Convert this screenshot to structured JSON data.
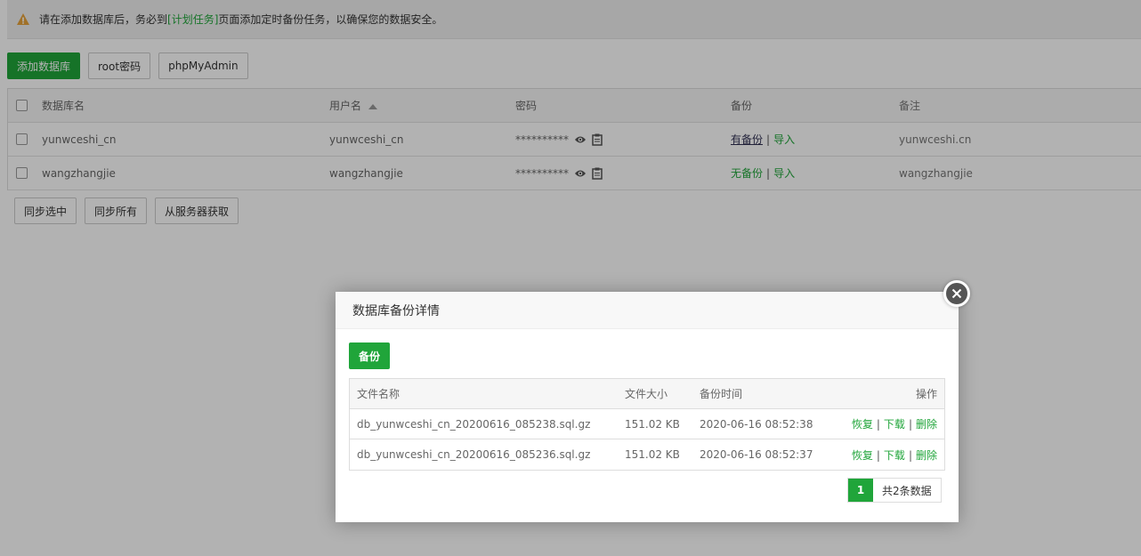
{
  "notice": {
    "prefix": "请在添加数据库后，务必到",
    "link": "[计划任务]",
    "suffix": "页面添加定时备份任务，以确保您的数据安全。"
  },
  "toolbar": {
    "add_db": "添加数据库",
    "root_pw": "root密码",
    "phpmyadmin": "phpMyAdmin"
  },
  "db_table": {
    "headers": {
      "name": "数据库名",
      "user": "用户名",
      "password": "密码",
      "backup": "备份",
      "note": "备注"
    },
    "rows": [
      {
        "name": "yunwceshi_cn",
        "user": "yunwceshi_cn",
        "password": "**********",
        "backup": "有备份",
        "import": "导入",
        "note": "yunwceshi.cn"
      },
      {
        "name": "wangzhangjie",
        "user": "wangzhangjie",
        "password": "**********",
        "backup": "无备份",
        "import": "导入",
        "note": "wangzhangjie"
      }
    ]
  },
  "bottom": {
    "sync_selected": "同步选中",
    "sync_all": "同步所有",
    "fetch_server": "从服务器获取"
  },
  "modal": {
    "title": "数据库备份详情",
    "backup_button": "备份",
    "headers": {
      "file": "文件名称",
      "size": "文件大小",
      "time": "备份时间",
      "ops": "操作"
    },
    "files": [
      {
        "name": "db_yunwceshi_cn_20200616_085238.sql.gz",
        "size": "151.02 KB",
        "time": "2020-06-16 08:52:38",
        "restore": "恢复",
        "download": "下载",
        "delete": "删除"
      },
      {
        "name": "db_yunwceshi_cn_20200616_085236.sql.gz",
        "size": "151.02 KB",
        "time": "2020-06-16 08:52:37",
        "restore": "恢复",
        "download": "下载",
        "delete": "删除"
      }
    ],
    "pager": {
      "current": "1",
      "total": "共2条数据"
    }
  },
  "colors": {
    "accent": "#20a53a",
    "warning": "#e6a23c"
  }
}
